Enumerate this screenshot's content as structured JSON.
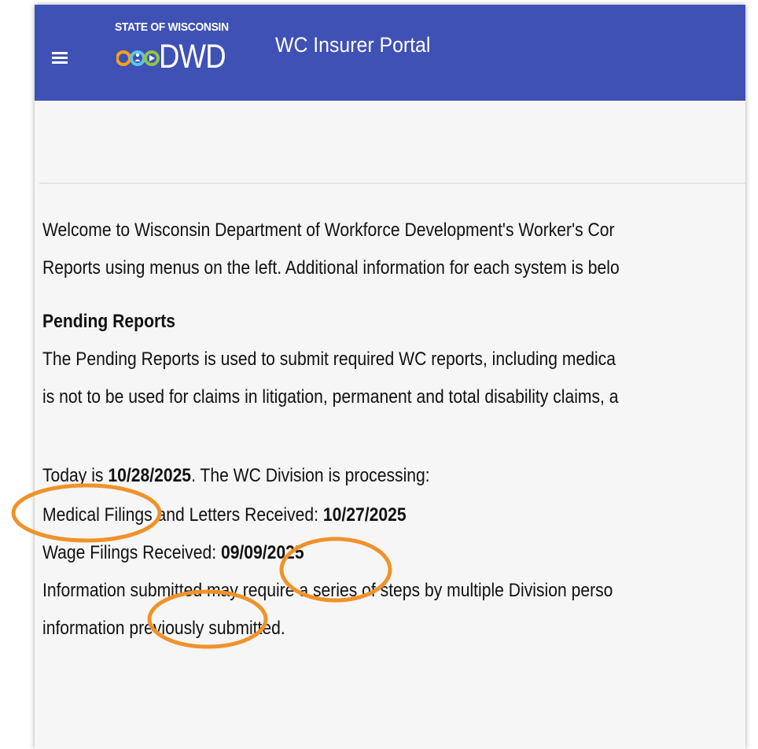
{
  "header": {
    "logo_state_text": "STATE OF WISCONSIN",
    "logo_agency_text": "DWD",
    "app_title": "WC Insurer Portal",
    "bar_color": "#3f51b5",
    "menu_icon": "hamburger-menu-icon"
  },
  "main": {
    "intro_line_1": "Welcome to Wisconsin Department of Workforce Development's Worker's Cor",
    "intro_line_2": "Reports using menus on the left. Additional information for each system is belo",
    "pending_heading": "Pending Reports",
    "pending_line_1": "The Pending Reports is used to submit required WC reports, including medica",
    "pending_line_2": "is not to be used for claims in litigation, permanent and total disability claims, a",
    "today_prefix": "Today is ",
    "today_date": "10/28/2025",
    "today_suffix": ". The WC Division is processing:",
    "medical_prefix": "Medical Filings and Letters Received: ",
    "medical_date": "10/27/2025",
    "wage_prefix": "Wage Filings Received: ",
    "wage_date": "09/09/2025",
    "info_line_1": "Information submitted may require a series of steps by multiple Division perso",
    "info_line_2": "information previously submitted."
  },
  "annotations": {
    "circle_color": "#f0922a"
  }
}
